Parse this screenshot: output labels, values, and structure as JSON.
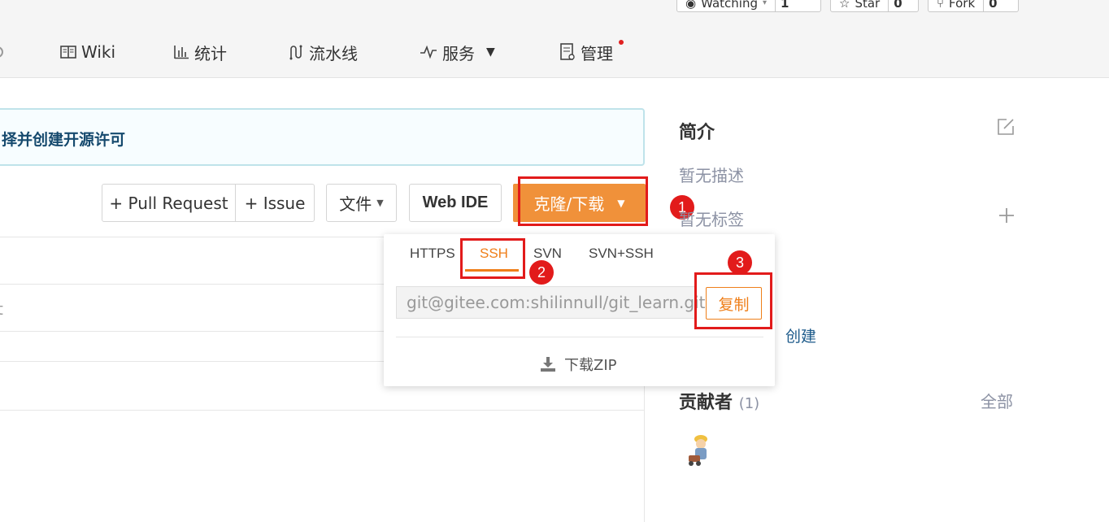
{
  "top_buttons": [
    {
      "label": "Watching",
      "count": "1"
    },
    {
      "label": "Star",
      "count": "0"
    },
    {
      "label": "Fork",
      "count": "0"
    }
  ],
  "nav": {
    "wiki": "Wiki",
    "stats": "统计",
    "pipeline": "流水线",
    "services": "服务",
    "manage": "管理"
  },
  "banner": {
    "text": "择并创建开源许可"
  },
  "actions": {
    "pull_request": "+ Pull Request",
    "issue": "+ Issue",
    "file": "文件",
    "web_ide": "Web IDE",
    "clone": "克隆/下载"
  },
  "row_fragment": "t",
  "clone_dropdown": {
    "protocols": [
      "HTTPS",
      "SSH",
      "SVN",
      "SVN+SSH"
    ],
    "selected": "SSH",
    "url": "git@gitee.com:shilinnull/git_learn.git",
    "copy_label": "复制",
    "download_zip": "下载ZIP"
  },
  "annotations": [
    "1",
    "2",
    "3"
  ],
  "sidebar": {
    "intro_title": "简介",
    "no_description": "暂无描述",
    "no_tags": "暂无标签",
    "create_link": "创建",
    "contributors_title": "贡献者",
    "contributors_count": "(1)",
    "all_link": "全部"
  },
  "colors": {
    "accent": "#f0913a",
    "annotation": "#e21b1b",
    "link": "#1c5a8a"
  }
}
